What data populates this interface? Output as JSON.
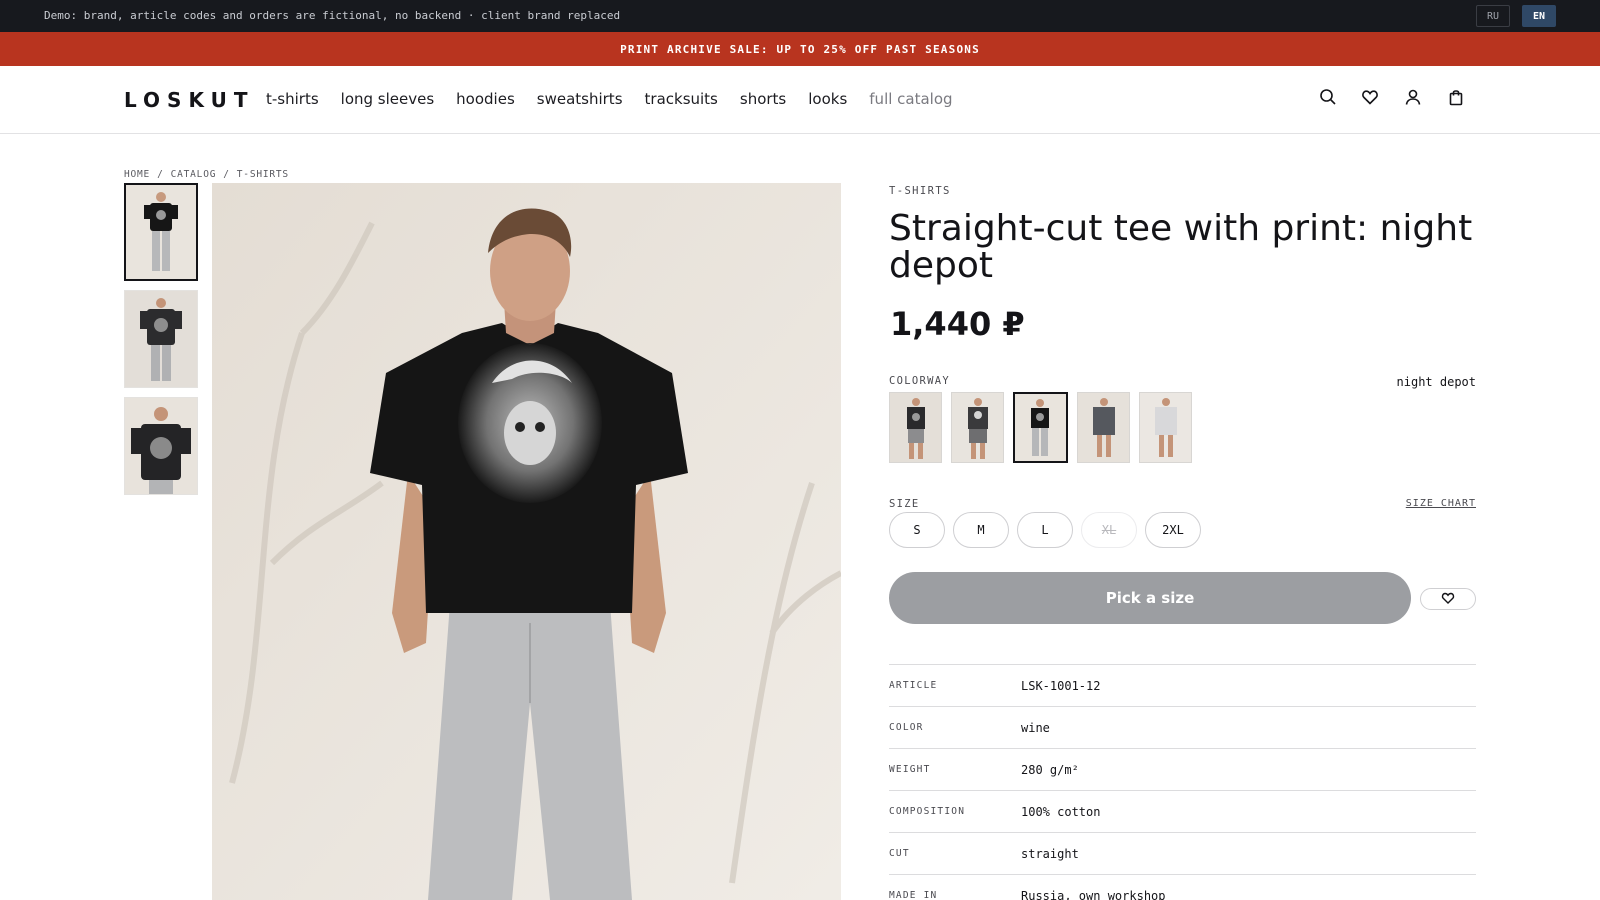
{
  "demo_bar": {
    "text": "Demo: brand, article codes and orders are fictional, no backend · client brand replaced",
    "languages": [
      "RU",
      "EN"
    ],
    "active_language": "EN"
  },
  "sale_bar": {
    "text": "PRINT ARCHIVE SALE: UP TO 25% OFF PAST SEASONS"
  },
  "header": {
    "logo": "LOSKUT",
    "nav": [
      "t-shirts",
      "long sleeves",
      "hoodies",
      "sweatshirts",
      "tracksuits",
      "shorts",
      "looks",
      "full catalog"
    ],
    "icons": [
      "search-icon",
      "heart-icon",
      "user-icon",
      "bag-icon"
    ]
  },
  "breadcrumb": [
    "HOME",
    "CATALOG",
    "T-SHIRTS"
  ],
  "breadcrumb_separator": "/",
  "product": {
    "category": "T-SHIRTS",
    "title": "Straight-cut tee with print: night depot",
    "price": "1,440 ₽",
    "colorway_label": "COLORWAY",
    "colorway_value": "night depot",
    "size_label": "SIZE",
    "size_chart_label": "SIZE CHART",
    "sizes": [
      "S",
      "M",
      "L",
      "XL",
      "2XL"
    ],
    "unavailable_sizes": [
      "XL"
    ],
    "cta_label": "Pick a size",
    "specs": [
      {
        "key": "ARTICLE",
        "value": "LSK-1001-12"
      },
      {
        "key": "COLOR",
        "value": "wine"
      },
      {
        "key": "WEIGHT",
        "value": "280 g/m²"
      },
      {
        "key": "COMPOSITION",
        "value": "100% cotton"
      },
      {
        "key": "CUT",
        "value": "straight"
      },
      {
        "key": "MADE IN",
        "value": "Russia, own workshop"
      }
    ]
  },
  "colors": {
    "demo_bg": "#17191e",
    "sale_bg": "#b8341f",
    "active_lang_bg": "#2f4866",
    "cta_bg": "#9c9ea2",
    "text": "#141418"
  }
}
